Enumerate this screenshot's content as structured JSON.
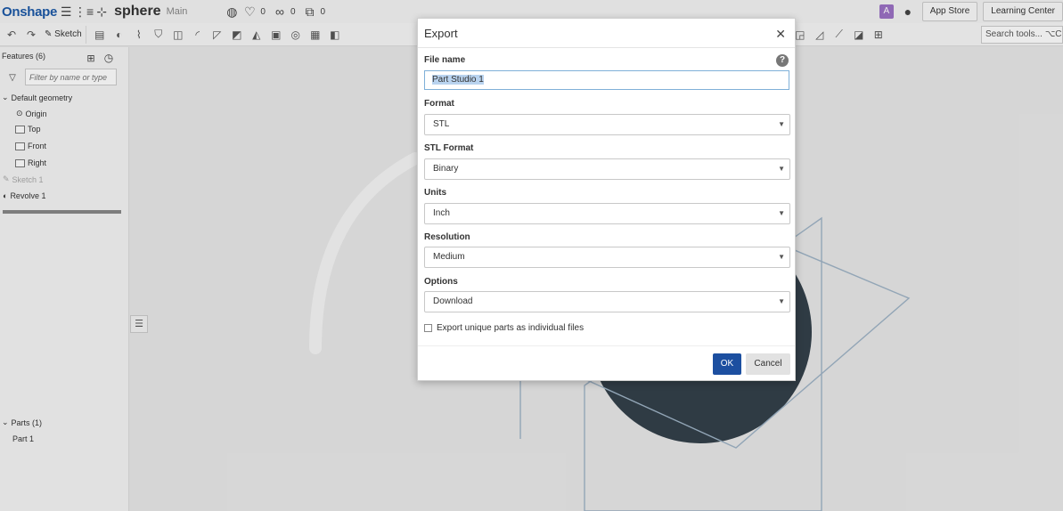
{
  "topbar": {
    "logo": "Onshape",
    "doc_name": "sphere",
    "branch": "Main",
    "likes": "0",
    "links": "0",
    "copies": "0",
    "avatar_letter": "A",
    "app_store": "App Store",
    "learning_center": "Learning Center"
  },
  "toolbar": {
    "sketch_label": "Sketch",
    "search_tools": "Search tools... ⌥C"
  },
  "sidebar": {
    "features_header": "Features (6)",
    "filter_placeholder": "Filter by name or type",
    "default_geometry": "Default geometry",
    "origin": "Origin",
    "top": "Top",
    "front": "Front",
    "right": "Right",
    "sketch1": "Sketch 1",
    "revolve1": "Revolve 1",
    "parts_header": "Parts (1)",
    "part1": "Part 1"
  },
  "dialog": {
    "title": "Export",
    "file_name_label": "File name",
    "file_name_value": "Part Studio 1",
    "format_label": "Format",
    "format_value": "STL",
    "stl_format_label": "STL Format",
    "stl_format_value": "Binary",
    "units_label": "Units",
    "units_value": "Inch",
    "resolution_label": "Resolution",
    "resolution_value": "Medium",
    "options_label": "Options",
    "options_value": "Download",
    "checkbox_label": "Export unique parts as individual files",
    "ok": "OK",
    "cancel": "Cancel"
  }
}
